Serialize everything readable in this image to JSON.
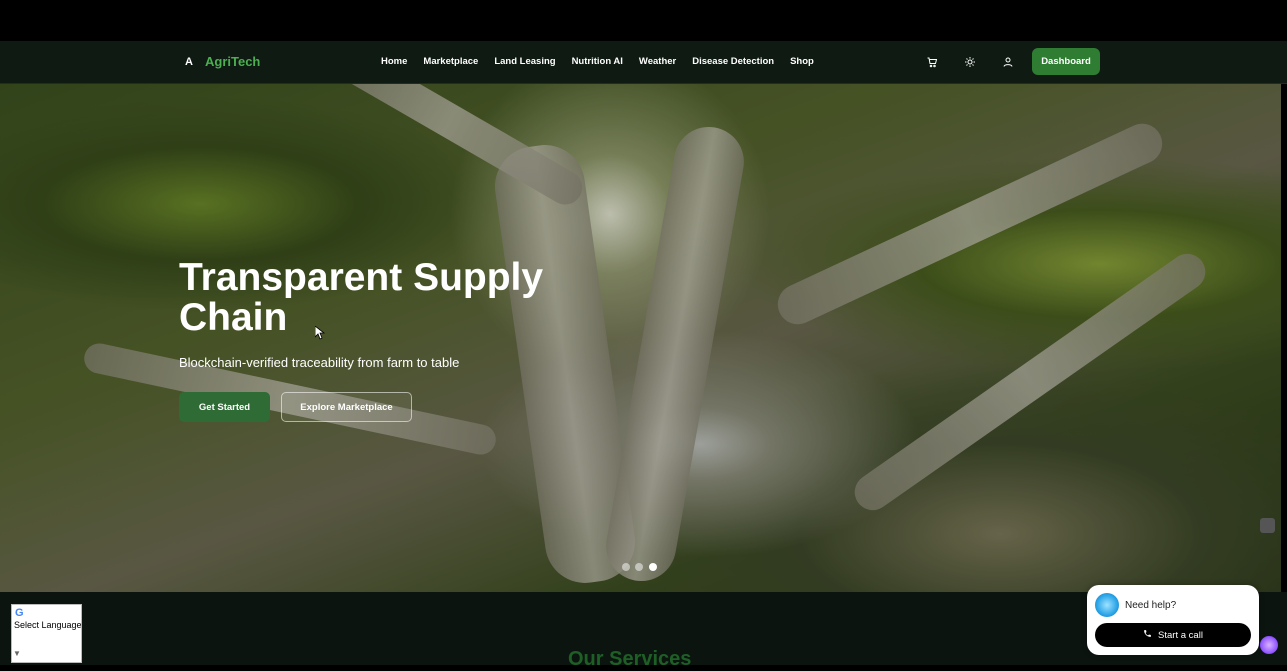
{
  "brand": {
    "initial": "A",
    "name": "AgriTech"
  },
  "nav": {
    "links": [
      "Home",
      "Marketplace",
      "Land Leasing",
      "Nutrition AI",
      "Weather",
      "Disease Detection",
      "Shop"
    ],
    "dashboard_label": "Dashboard"
  },
  "icons": {
    "cart": "cart-icon",
    "theme": "sun-icon",
    "account": "user-icon"
  },
  "hero": {
    "title": "Transparent Supply Chain",
    "subtitle": "Blockchain-verified traceability from farm to table",
    "primary_button": "Get Started",
    "secondary_button": "Explore Marketplace",
    "slides_total": 3,
    "active_slide": 3
  },
  "services": {
    "title": "Our Services"
  },
  "language": {
    "label": "Select Language",
    "logo_letter": "G"
  },
  "help": {
    "prompt": "Need help?",
    "call_label": "Start a call"
  },
  "colors": {
    "brand_green": "#4caf50",
    "button_green": "#2e7d32",
    "nav_bg": "#0e1a12"
  }
}
